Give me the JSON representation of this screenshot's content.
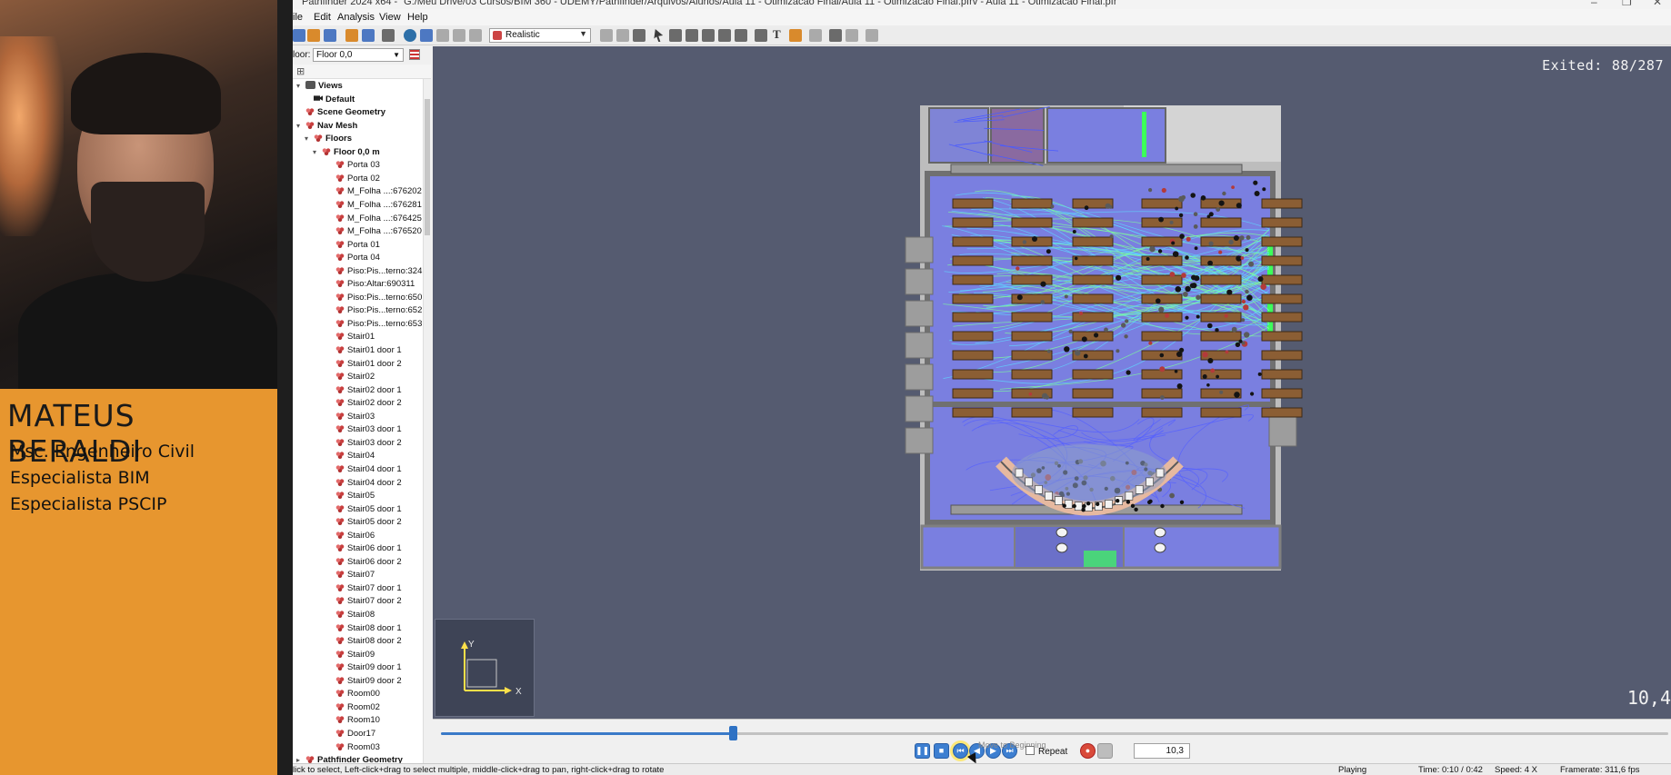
{
  "presenter": {
    "name": "MATEUS BERALDI",
    "credentials": [
      "Msc. Engenheiro Civil",
      "Especialista BIM",
      "Especialista PSCIP"
    ]
  },
  "window": {
    "title": "Pathfinder 2024 x64 - \"G:/Meu Drive/03 Cursos/BIM 360 - UDEMY/Pathfinder/Arquivos/Alunos/Aula 11 - Otimizacao Final/Aula 11 - Otimizacao Final.pfrv - Aula 11 - Otimizacao Final.pfr"
  },
  "menu": [
    "ile",
    "Edit",
    "Analysis",
    "View",
    "Help"
  ],
  "toolbar": {
    "view_mode": "Realistic"
  },
  "nav": {
    "floor_label": "loor:",
    "floor_value": "Floor 0,0",
    "items": [
      {
        "label": "Views",
        "depth": 0,
        "exp": "▾",
        "icon": "eye",
        "bold": true
      },
      {
        "label": "Default",
        "depth": 1,
        "exp": "",
        "icon": "cam",
        "bold": true
      },
      {
        "label": "Scene Geometry",
        "depth": 0,
        "exp": "",
        "icon": "geo",
        "bold": true
      },
      {
        "label": "Nav Mesh",
        "depth": 0,
        "exp": "▾",
        "icon": "geo",
        "bold": true
      },
      {
        "label": "Floors",
        "depth": 1,
        "exp": "▾",
        "icon": "geo",
        "bold": true
      },
      {
        "label": "Floor 0,0 m",
        "depth": 2,
        "exp": "▾",
        "icon": "geo",
        "bold": true
      },
      {
        "label": "Porta 03",
        "depth": 3,
        "icon": "geo"
      },
      {
        "label": "Porta 02",
        "depth": 3,
        "icon": "geo"
      },
      {
        "label": "M_Folha ...:676202",
        "depth": 3,
        "icon": "geo"
      },
      {
        "label": "M_Folha ...:676281",
        "depth": 3,
        "icon": "geo"
      },
      {
        "label": "M_Folha ...:676425",
        "depth": 3,
        "icon": "geo"
      },
      {
        "label": "M_Folha ...:676520",
        "depth": 3,
        "icon": "geo"
      },
      {
        "label": "Porta 01",
        "depth": 3,
        "icon": "geo"
      },
      {
        "label": "Porta 04",
        "depth": 3,
        "icon": "geo"
      },
      {
        "label": "Piso:Pis...terno:324",
        "depth": 3,
        "icon": "geo"
      },
      {
        "label": "Piso:Altar:690311",
        "depth": 3,
        "icon": "geo"
      },
      {
        "label": "Piso:Pis...terno:650",
        "depth": 3,
        "icon": "geo"
      },
      {
        "label": "Piso:Pis...terno:652",
        "depth": 3,
        "icon": "geo"
      },
      {
        "label": "Piso:Pis...terno:653",
        "depth": 3,
        "icon": "geo"
      },
      {
        "label": "Stair01",
        "depth": 3,
        "icon": "geo"
      },
      {
        "label": "Stair01 door 1",
        "depth": 3,
        "icon": "geo"
      },
      {
        "label": "Stair01 door 2",
        "depth": 3,
        "icon": "geo"
      },
      {
        "label": "Stair02",
        "depth": 3,
        "icon": "geo"
      },
      {
        "label": "Stair02 door 1",
        "depth": 3,
        "icon": "geo"
      },
      {
        "label": "Stair02 door 2",
        "depth": 3,
        "icon": "geo"
      },
      {
        "label": "Stair03",
        "depth": 3,
        "icon": "geo"
      },
      {
        "label": "Stair03 door 1",
        "depth": 3,
        "icon": "geo"
      },
      {
        "label": "Stair03 door 2",
        "depth": 3,
        "icon": "geo"
      },
      {
        "label": "Stair04",
        "depth": 3,
        "icon": "geo"
      },
      {
        "label": "Stair04 door 1",
        "depth": 3,
        "icon": "geo"
      },
      {
        "label": "Stair04 door 2",
        "depth": 3,
        "icon": "geo"
      },
      {
        "label": "Stair05",
        "depth": 3,
        "icon": "geo"
      },
      {
        "label": "Stair05 door 1",
        "depth": 3,
        "icon": "geo"
      },
      {
        "label": "Stair05 door 2",
        "depth": 3,
        "icon": "geo"
      },
      {
        "label": "Stair06",
        "depth": 3,
        "icon": "geo"
      },
      {
        "label": "Stair06 door 1",
        "depth": 3,
        "icon": "geo"
      },
      {
        "label": "Stair06 door 2",
        "depth": 3,
        "icon": "geo"
      },
      {
        "label": "Stair07",
        "depth": 3,
        "icon": "geo"
      },
      {
        "label": "Stair07 door 1",
        "depth": 3,
        "icon": "geo"
      },
      {
        "label": "Stair07 door 2",
        "depth": 3,
        "icon": "geo"
      },
      {
        "label": "Stair08",
        "depth": 3,
        "icon": "geo"
      },
      {
        "label": "Stair08 door 1",
        "depth": 3,
        "icon": "geo"
      },
      {
        "label": "Stair08 door 2",
        "depth": 3,
        "icon": "geo"
      },
      {
        "label": "Stair09",
        "depth": 3,
        "icon": "geo"
      },
      {
        "label": "Stair09 door 1",
        "depth": 3,
        "icon": "geo"
      },
      {
        "label": "Stair09 door 2",
        "depth": 3,
        "icon": "geo"
      },
      {
        "label": "Room00",
        "depth": 3,
        "icon": "geo"
      },
      {
        "label": "Room02",
        "depth": 3,
        "icon": "geo"
      },
      {
        "label": "Room10",
        "depth": 3,
        "icon": "geo"
      },
      {
        "label": "Door17",
        "depth": 3,
        "icon": "geo"
      },
      {
        "label": "Room03",
        "depth": 3,
        "icon": "geo"
      },
      {
        "label": "Pathfinder Geometry",
        "depth": 0,
        "exp": "▸",
        "icon": "geo",
        "bold": true
      }
    ]
  },
  "viewport": {
    "exited_label": "Exited:",
    "exited_value": "88/287",
    "cut_value": "10,4",
    "axis_y": "Y",
    "axis_x": "X"
  },
  "playback": {
    "progress": 0.238,
    "tooltip": "Move to Beginning",
    "repeat_label": "Repeat",
    "speed_value": "10,3"
  },
  "status": {
    "hint": "lick to select, Left-click+drag to select multiple, middle-click+drag to pan, right-click+drag to rotate",
    "state": "Playing",
    "time": "Time: 0:10 / 0:42",
    "speed": "Speed: 4 X",
    "framerate": "Framerate: 311,6 fps"
  },
  "colors": {
    "presenter_bg": "#e7962f",
    "viewport_bg": "#555b70",
    "room_fill": "#7a7fe0",
    "wall": "#9a9a9a",
    "pew": "#8b5e34",
    "path_green": "#7dff9a",
    "path_cyan": "#5fd8ff",
    "exit_green": "#3cff5a"
  }
}
